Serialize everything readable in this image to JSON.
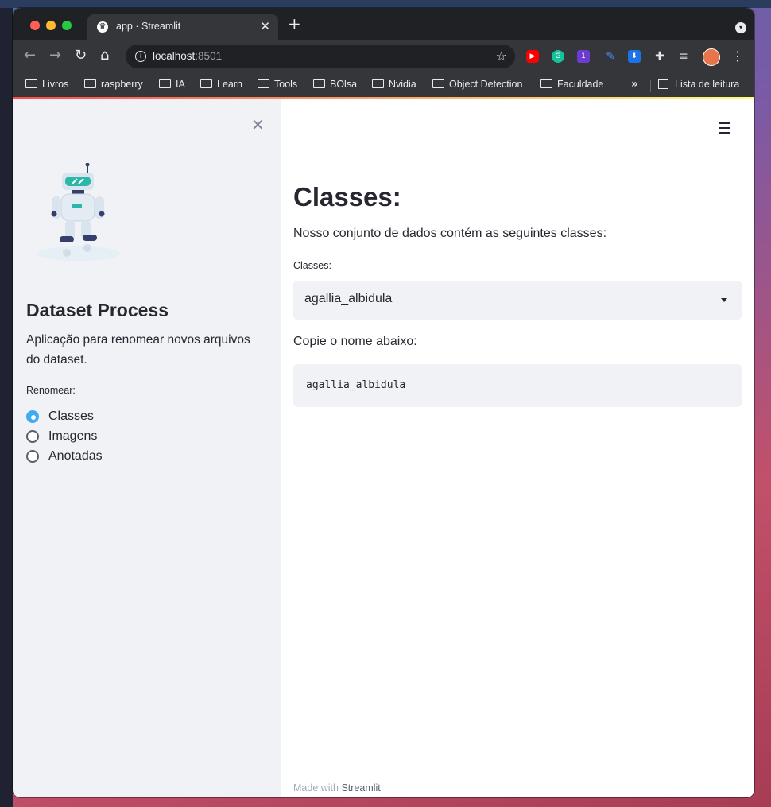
{
  "browser": {
    "tab_title": "app · Streamlit",
    "url_host": "localhost",
    "url_port": ":8501",
    "bookmarks": [
      "Livros",
      "raspberry",
      "IA",
      "Learn",
      "Tools",
      "BOlsa",
      "Nvidia",
      "Object Detection",
      "Faculdade"
    ],
    "bookmarks_more": "»",
    "reading_list": "Lista de leitura",
    "extension_badge": "1"
  },
  "sidebar": {
    "title": "Dataset Process",
    "description": "Aplicação para renomear novos arquivos do dataset.",
    "radio_label": "Renomear:",
    "options": [
      "Classes",
      "Imagens",
      "Anotadas"
    ],
    "selected_option": "Classes"
  },
  "main": {
    "title": "Classes:",
    "description": "Nosso conjunto de dados contém as seguintes classes:",
    "select_label": "Classes:",
    "select_value": "agallia_albidula",
    "copy_label": "Copie o nome abaixo:",
    "code_value": "agallia_albidula",
    "footer_prefix": "Made with",
    "footer_brand": "Streamlit"
  },
  "colors": {
    "primary": "#3eabf3",
    "sidebar_bg": "#f0f2f6",
    "text": "#262730",
    "decoration_start": "#ff4b4b",
    "decoration_end": "#fffd80"
  },
  "icons": {
    "close": "close-icon",
    "menu": "hamburger-menu-icon",
    "select_caret": "chevron-down-icon"
  }
}
